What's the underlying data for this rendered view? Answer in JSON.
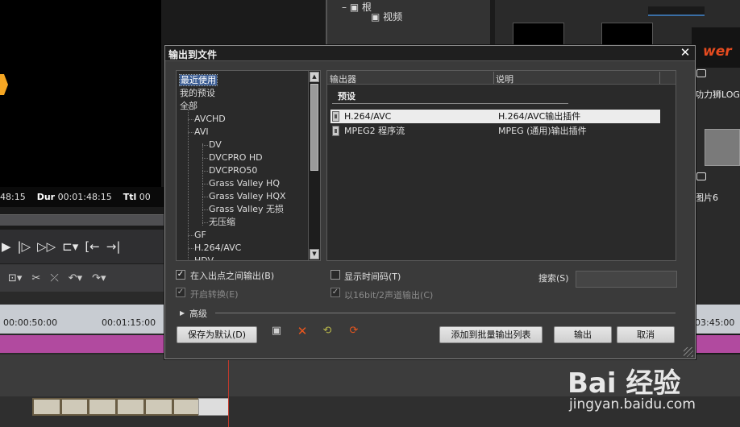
{
  "background": {
    "timecode": {
      "in": "48:15",
      "dur_label": "Dur",
      "dur": "00:01:48:15",
      "ttl_label": "Ttl",
      "ttl": "00"
    },
    "bin": {
      "root": "根",
      "video": "视频"
    },
    "right_labels": [
      "功力狮LOGO",
      "图片6"
    ],
    "logo_text": "wer",
    "ruler": [
      "00:00:50:00",
      "00:01:15:00",
      "03:45:00"
    ],
    "watermark": {
      "main": "Bai 经验",
      "url": "jingyan.baidu.com"
    }
  },
  "dialog": {
    "title": "输出到文件",
    "tree": [
      {
        "label": "最近使用",
        "level": 0,
        "selected": true
      },
      {
        "label": "我的预设",
        "level": 0
      },
      {
        "label": "全部",
        "level": 0
      },
      {
        "label": "AVCHD",
        "level": 1
      },
      {
        "label": "AVI",
        "level": 1
      },
      {
        "label": "DV",
        "level": 2
      },
      {
        "label": "DVCPRO HD",
        "level": 2
      },
      {
        "label": "DVCPRO50",
        "level": 2
      },
      {
        "label": "Grass Valley HQ",
        "level": 2
      },
      {
        "label": "Grass Valley HQX",
        "level": 2
      },
      {
        "label": "Grass Valley 无损",
        "level": 2
      },
      {
        "label": "无压缩",
        "level": 2
      },
      {
        "label": "GF",
        "level": 1
      },
      {
        "label": "H.264/AVC",
        "level": 1
      },
      {
        "label": "HDV",
        "level": 1
      }
    ],
    "list": {
      "columns": [
        "输出器",
        "说明"
      ],
      "group": "预设",
      "rows": [
        {
          "name": "H.264/AVC",
          "desc": "H.264/AVC输出插件",
          "selected": true
        },
        {
          "name": "MPEG2 程序流",
          "desc": "MPEG (通用)输出插件",
          "selected": false
        }
      ]
    },
    "options": {
      "in_out": {
        "label": "在入出点之间输出(B)",
        "checked": true,
        "enabled": true
      },
      "convert": {
        "label": "开启转换(E)",
        "checked": true,
        "enabled": false
      },
      "timecode": {
        "label": "显示时间码(T)",
        "checked": false,
        "enabled": true
      },
      "bit16": {
        "label": "以16bit/2声道输出(C)",
        "checked": true,
        "enabled": false
      },
      "search_label": "搜索(S)",
      "search_value": ""
    },
    "advanced_label": "高级",
    "buttons": {
      "save_default": "保存为默认(D)",
      "add_batch": "添加到批量输出列表",
      "export": "输出",
      "cancel": "取消"
    }
  }
}
